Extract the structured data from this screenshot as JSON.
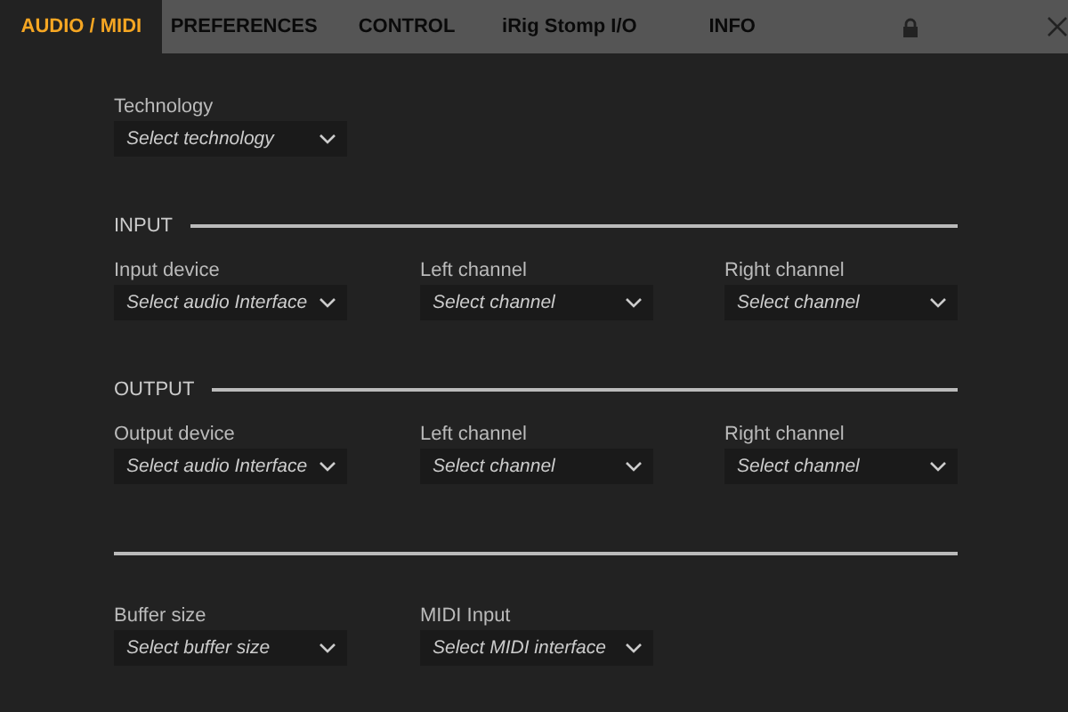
{
  "tabs": [
    {
      "label": "AUDIO / MIDI",
      "selected": true
    },
    {
      "label": "PREFERENCES",
      "selected": false
    },
    {
      "label": "CONTROL",
      "selected": false
    },
    {
      "label": "iRig Stomp I/O",
      "selected": false
    },
    {
      "label": "INFO",
      "selected": false
    }
  ],
  "technology": {
    "label": "Technology",
    "placeholder": "Select technology"
  },
  "sections": [
    {
      "title": "INPUT",
      "fields": [
        {
          "label": "Input device",
          "placeholder": "Select audio Interface"
        },
        {
          "label": "Left channel",
          "placeholder": "Select channel"
        },
        {
          "label": "Right channel",
          "placeholder": "Select channel"
        }
      ]
    },
    {
      "title": "OUTPUT",
      "fields": [
        {
          "label": "Output device",
          "placeholder": "Select audio Interface"
        },
        {
          "label": "Left channel",
          "placeholder": "Select channel"
        },
        {
          "label": "Right channel",
          "placeholder": "Select channel"
        }
      ]
    },
    {
      "fields": [
        {
          "label": "Buffer size",
          "placeholder": "Select buffer size"
        },
        {
          "label": "MIDI Input",
          "placeholder": "Select MIDI interface"
        }
      ]
    }
  ]
}
